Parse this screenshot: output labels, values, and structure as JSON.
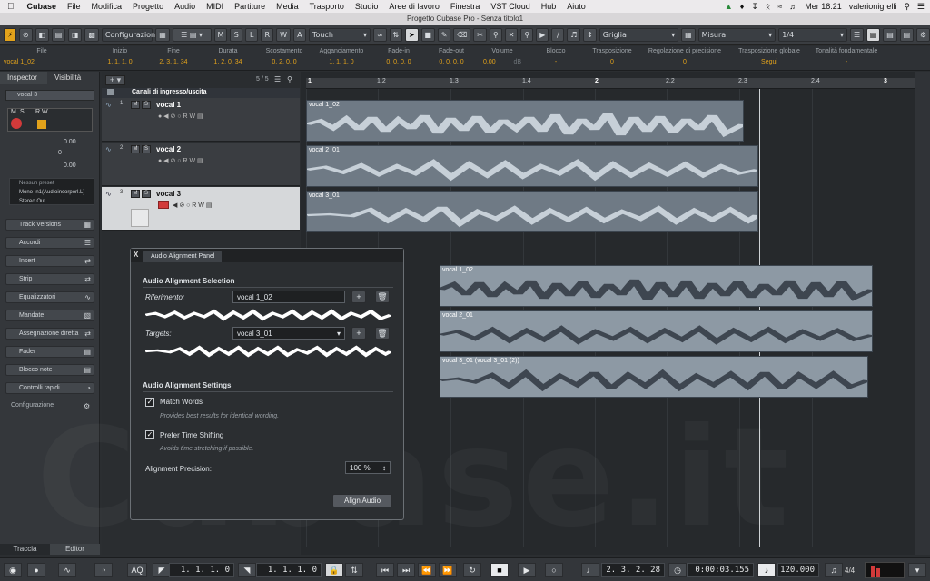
{
  "menubar": {
    "apple": "",
    "app": "Cubase",
    "items": [
      "File",
      "Modifica",
      "Progetto",
      "Audio",
      "MIDI",
      "Partiture",
      "Media",
      "Trasporto",
      "Studio",
      "Aree di lavoro",
      "Finestra",
      "VST Cloud",
      "Hub",
      "Aiuto"
    ],
    "clock": "Mer 18:21",
    "user": "valerionigrelli"
  },
  "window": {
    "title": "Progetto Cubase Pro - Senza titolo1"
  },
  "toolbar": {
    "configurazioni": "Configurazioni",
    "mode_buttons": [
      "M",
      "S",
      "L",
      "R",
      "W",
      "A"
    ],
    "automation_mode": "Touch",
    "snap_mode": "Griglia",
    "grid_type": "Misura",
    "quantize": "1/4"
  },
  "infoline": {
    "headers": [
      "File",
      "Inizio",
      "Fine",
      "Durata",
      "Scostamento",
      "Agganciamento",
      "Fade-in",
      "Fade-out",
      "Volume",
      "Blocco",
      "Trasposizione",
      "Regolazione di precisione",
      "Trasposizione globale",
      "Tonalità fondamentale"
    ],
    "values": [
      "vocal 1_02",
      "1. 1. 1. 0",
      "2. 3. 1. 34",
      "1. 2. 0. 34",
      "0. 2. 0. 0",
      "1. 1. 1. 0",
      "0. 0. 0. 0",
      "0. 0. 0. 0",
      "0.00",
      "-",
      "0",
      "0",
      "Segui",
      "-"
    ],
    "volume_unit": "dB"
  },
  "inspector": {
    "tab_inspector": "Inspector",
    "tab_visibility": "Visibilità",
    "track_name": "vocal 3",
    "volume": "0.00",
    "pan": "0",
    "delay": "0.00",
    "preset": "Nessun preset",
    "input": "Mono In1(Audioincorporl.L)",
    "output": "Stereo Out",
    "sections": [
      "Track Versions",
      "Accordi",
      "Insert",
      "Strip",
      "Equalizzatori",
      "Mandate",
      "Assegnazione diretta",
      "Fader",
      "Blocco note",
      "Controlli rapidi"
    ],
    "config": "Configurazione",
    "bottom_tab_track": "Traccia",
    "bottom_tab_editor": "Editor"
  },
  "tracklist": {
    "count": "5 / 5",
    "folder": "Canali di ingresso/uscita",
    "tracks": [
      {
        "num": "1",
        "name": "vocal 1"
      },
      {
        "num": "2",
        "name": "vocal 2"
      },
      {
        "num": "3",
        "name": "vocal 3"
      }
    ]
  },
  "ruler": {
    "labels": [
      "1",
      "1.2",
      "1.3",
      "1.4",
      "2",
      "2.2",
      "2.3",
      "2.4",
      "3"
    ]
  },
  "events": {
    "top": [
      "vocal 1_02",
      "vocal 2_01",
      "vocal 3_01"
    ],
    "lower": [
      "vocal 1_02",
      "vocal 2_01",
      "vocal 3_01 (vocal 3_01 (2))"
    ]
  },
  "panel": {
    "close": "X",
    "tab": "Audio Alignment Panel",
    "selection_title": "Audio Alignment Selection",
    "reference_label": "Riferimento:",
    "reference_value": "vocal 1_02",
    "targets_label": "Targets:",
    "targets_value": "vocal 3_01",
    "settings_title": "Audio Alignment Settings",
    "match_words": "Match Words",
    "match_words_hint": "Provides best results for identical wording.",
    "match_words_checked": true,
    "prefer_shift": "Prefer Time Shifting",
    "prefer_shift_hint": "Avoids time stretching if possible.",
    "prefer_shift_checked": true,
    "precision_label": "Alignment Precision:",
    "precision_value": "100 %",
    "align_button": "Align Audio"
  },
  "transport": {
    "left_locator": "1. 1. 1. 0",
    "right_locator": "1. 1. 1. 0",
    "position": "2. 3. 2. 28",
    "time": "0:00:03.155",
    "tempo": "120.000",
    "signature": "4/4",
    "aq": "AQ"
  },
  "watermark": "Cubase.it",
  "colors": {
    "accent": "#e2a21b",
    "record": "#d23a3a",
    "selected_track": "#d6d8da"
  }
}
